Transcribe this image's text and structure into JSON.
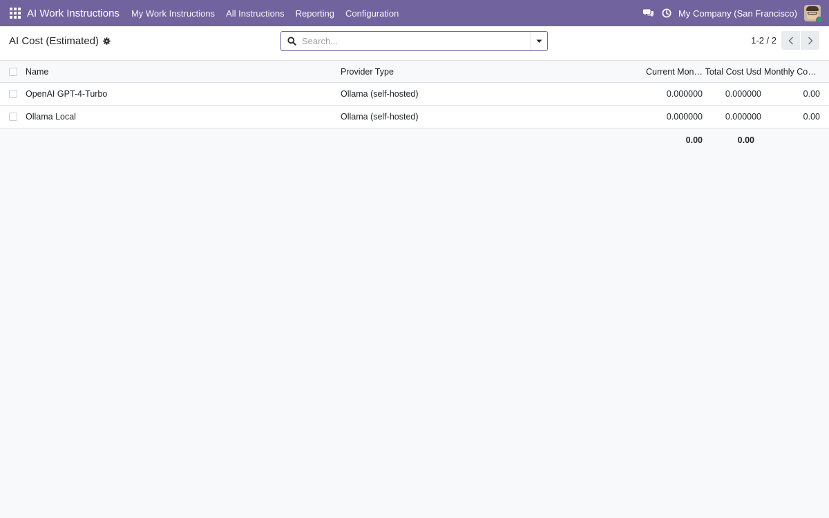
{
  "navbar": {
    "app_name": "AI Work Instructions",
    "menu": [
      "My Work Instructions",
      "All Instructions",
      "Reporting",
      "Configuration"
    ],
    "company": "My Company (San Francisco)",
    "icons": [
      "apps-grid-icon",
      "chat-icon",
      "clock-icon"
    ],
    "brand_color": "#71639e"
  },
  "control_panel": {
    "breadcrumb": "AI Cost (Estimated)",
    "search_placeholder": "Search...",
    "pager_value": "1-2 / 2"
  },
  "table": {
    "columns": [
      "Name",
      "Provider Type",
      "Current Mon…",
      "Total Cost Usd",
      "Monthly Cos…"
    ],
    "rows": [
      {
        "name": "OpenAI GPT-4-Turbo",
        "provider": "Ollama (self-hosted)",
        "current_month": "0.000000",
        "total_cost": "0.000000",
        "monthly_cost": "0.00"
      },
      {
        "name": "Ollama Local",
        "provider": "Ollama (self-hosted)",
        "current_month": "0.000000",
        "total_cost": "0.000000",
        "monthly_cost": "0.00"
      }
    ],
    "totals": {
      "current_month": "0.00",
      "total_cost": "0.00"
    }
  }
}
